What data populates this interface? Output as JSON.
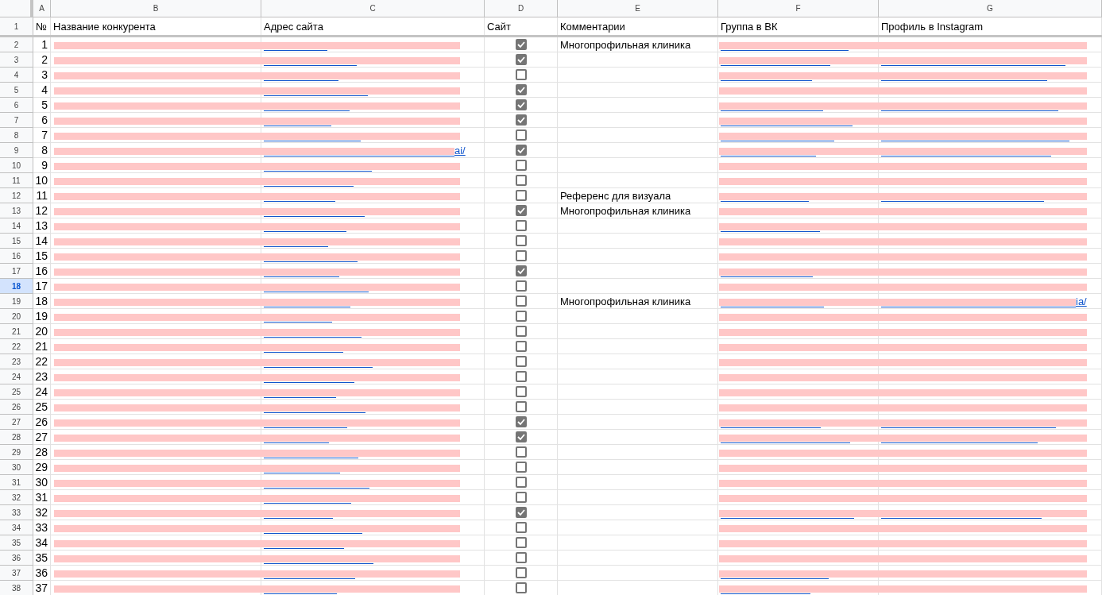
{
  "columns": [
    "A",
    "B",
    "C",
    "D",
    "E",
    "F",
    "G"
  ],
  "header": {
    "row_number": "1",
    "cells": [
      "№",
      "Название конкурента",
      "Адрес сайта",
      "Сайт",
      "Комментарии",
      "Группа в ВК",
      "Профиль в Instagram"
    ]
  },
  "rows": [
    {
      "row_number": "2",
      "selected": false,
      "number": "1",
      "site": true,
      "comment": "Многопрофильная клиника",
      "vk_link": true,
      "instagram_link": false
    },
    {
      "row_number": "3",
      "selected": false,
      "number": "2",
      "site": true,
      "vk_link": true,
      "instagram_link": true
    },
    {
      "row_number": "4",
      "selected": false,
      "number": "3",
      "site": false,
      "vk_link": true,
      "instagram_link": true
    },
    {
      "row_number": "5",
      "selected": false,
      "number": "4",
      "site": true,
      "vk_link": false,
      "instagram_link": false
    },
    {
      "row_number": "6",
      "selected": false,
      "number": "5",
      "site": true,
      "vk_link": true,
      "instagram_link": true
    },
    {
      "row_number": "7",
      "selected": false,
      "number": "6",
      "site": true,
      "vk_link": true,
      "instagram_link": false
    },
    {
      "row_number": "8",
      "selected": false,
      "number": "7",
      "site": false,
      "vk_link": true,
      "instagram_link": true
    },
    {
      "row_number": "9",
      "selected": false,
      "number": "8",
      "site": true,
      "url_tail": "ai/",
      "vk_link": true,
      "instagram_link": true
    },
    {
      "row_number": "10",
      "selected": false,
      "number": "9",
      "site": false,
      "vk_link": false,
      "instagram_link": false
    },
    {
      "row_number": "11",
      "selected": false,
      "number": "10",
      "site": false,
      "vk_link": false,
      "instagram_link": false
    },
    {
      "row_number": "12",
      "selected": false,
      "number": "11",
      "site": false,
      "comment": "Референс для визуала",
      "vk_link": true,
      "instagram_link": true
    },
    {
      "row_number": "13",
      "selected": false,
      "number": "12",
      "site": true,
      "comment": "Многопрофильная клиника",
      "vk_link": false,
      "instagram_link": false
    },
    {
      "row_number": "14",
      "selected": false,
      "number": "13",
      "site": false,
      "vk_link": true,
      "instagram_link": false
    },
    {
      "row_number": "15",
      "selected": false,
      "number": "14",
      "site": false,
      "vk_link": false,
      "instagram_link": false
    },
    {
      "row_number": "16",
      "selected": false,
      "number": "15",
      "site": false,
      "vk_link": false,
      "instagram_link": false
    },
    {
      "row_number": "17",
      "selected": false,
      "number": "16",
      "site": true,
      "vk_link": true,
      "instagram_link": false
    },
    {
      "row_number": "18",
      "selected": true,
      "number": "17",
      "site": false,
      "vk_link": false,
      "instagram_link": false
    },
    {
      "row_number": "19",
      "selected": false,
      "number": "18",
      "site": false,
      "comment": "Многопрофильная клиника",
      "vk_link": true,
      "instagram_link": true,
      "instagram_tail": "ia/"
    },
    {
      "row_number": "20",
      "selected": false,
      "number": "19",
      "site": false,
      "vk_link": false,
      "instagram_link": false
    },
    {
      "row_number": "21",
      "selected": false,
      "number": "20",
      "site": false,
      "vk_link": false,
      "instagram_link": false
    },
    {
      "row_number": "22",
      "selected": false,
      "number": "21",
      "site": false,
      "vk_link": false,
      "instagram_link": false
    },
    {
      "row_number": "23",
      "selected": false,
      "number": "22",
      "site": false,
      "vk_link": false,
      "instagram_link": false
    },
    {
      "row_number": "24",
      "selected": false,
      "number": "23",
      "site": false,
      "vk_link": false,
      "instagram_link": false
    },
    {
      "row_number": "25",
      "selected": false,
      "number": "24",
      "site": false,
      "vk_link": false,
      "instagram_link": false
    },
    {
      "row_number": "26",
      "selected": false,
      "number": "25",
      "site": false,
      "vk_link": false,
      "instagram_link": false
    },
    {
      "row_number": "27",
      "selected": false,
      "number": "26",
      "site": true,
      "vk_link": true,
      "instagram_link": true
    },
    {
      "row_number": "28",
      "selected": false,
      "number": "27",
      "site": true,
      "vk_link": true,
      "instagram_link": true
    },
    {
      "row_number": "29",
      "selected": false,
      "number": "28",
      "site": false,
      "vk_link": false,
      "instagram_link": false
    },
    {
      "row_number": "30",
      "selected": false,
      "number": "29",
      "site": false,
      "vk_link": false,
      "instagram_link": false
    },
    {
      "row_number": "31",
      "selected": false,
      "number": "30",
      "site": false,
      "vk_link": false,
      "instagram_link": false
    },
    {
      "row_number": "32",
      "selected": false,
      "number": "31",
      "site": false,
      "vk_link": false,
      "instagram_link": false
    },
    {
      "row_number": "33",
      "selected": false,
      "number": "32",
      "site": true,
      "vk_link": true,
      "instagram_link": true
    },
    {
      "row_number": "34",
      "selected": false,
      "number": "33",
      "site": false,
      "vk_link": false,
      "instagram_link": false
    },
    {
      "row_number": "35",
      "selected": false,
      "number": "34",
      "site": false,
      "vk_link": false,
      "instagram_link": false
    },
    {
      "row_number": "36",
      "selected": false,
      "number": "35",
      "site": false,
      "vk_link": false,
      "instagram_link": false
    },
    {
      "row_number": "37",
      "selected": false,
      "number": "36",
      "site": false,
      "vk_link": true,
      "instagram_link": false
    },
    {
      "row_number": "38",
      "selected": false,
      "number": "37",
      "site": false,
      "vk_link": true,
      "instagram_link": false
    }
  ]
}
